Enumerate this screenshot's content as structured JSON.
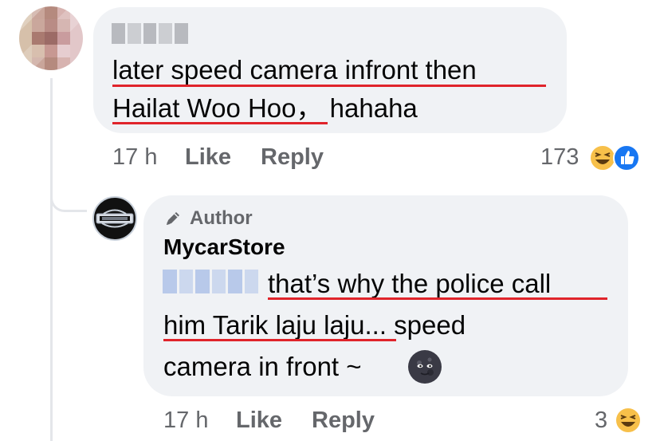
{
  "comment": {
    "text_line1": "later speed camera infront then",
    "text_line2": "Hailat Woo Hoo， hahaha",
    "time": "17 h",
    "like_label": "Like",
    "reply_label": "Reply",
    "reaction_count": "173",
    "reactions": [
      "haha-emoji",
      "like-emoji"
    ]
  },
  "reply": {
    "badge": "Author",
    "author": "MycarStore",
    "text_line1": "that’s why the police call",
    "text_line2": "him Tarik laju laju... speed",
    "text_line3": "camera in front ~",
    "time": "17 h",
    "like_label": "Like",
    "reply_label": "Reply",
    "reaction_count": "3",
    "reactions": [
      "haha-emoji"
    ]
  },
  "colors": {
    "bubble": "#f0f2f5",
    "underline": "#e0242b",
    "meta": "#65676b",
    "like_blue": "#1877f2",
    "emoji_yellow": "#f7c04a"
  }
}
